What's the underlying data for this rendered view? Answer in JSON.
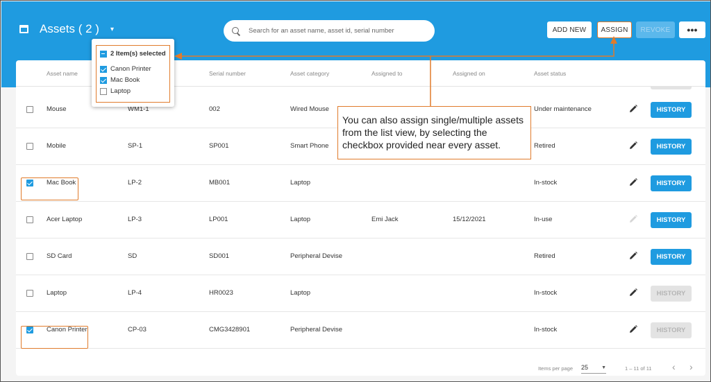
{
  "header": {
    "title": "Assets ( 2 )",
    "title_caret": "▾",
    "search_placeholder": "Search for an asset name, asset id, serial number",
    "add_new_label": "ADD NEW",
    "assign_label": "ASSIGN",
    "revoke_label": "REVOKE",
    "more_label": "•••"
  },
  "table": {
    "columns": [
      "Asset name",
      "",
      "Serial number",
      "Asset category",
      "Assigned to",
      "Assigned on",
      "Asset status"
    ],
    "rows": [
      {
        "checked": false,
        "name": "Mouse",
        "id": "WM1-1",
        "serial": "002",
        "category": "Wired Mouse",
        "assigned_to": "",
        "assigned_on": "",
        "status": "Under maintenance",
        "history": "HISTORY",
        "history_enabled": true
      },
      {
        "checked": false,
        "name": "Mobile",
        "id": "SP-1",
        "serial": "SP001",
        "category": "Smart Phone",
        "assigned_to": "",
        "assigned_on": "",
        "status": "Retired",
        "history": "HISTORY",
        "history_enabled": true
      },
      {
        "checked": true,
        "name": "Mac Book",
        "id": "LP-2",
        "serial": "MB001",
        "category": "Laptop",
        "assigned_to": "",
        "assigned_on": "",
        "status": "In-stock",
        "history": "HISTORY",
        "history_enabled": true
      },
      {
        "checked": false,
        "name": "Acer Laptop",
        "id": "LP-3",
        "serial": "LP001",
        "category": "Laptop",
        "assigned_to": "Emi Jack",
        "assigned_on": "15/12/2021",
        "status": "In-use",
        "history": "HISTORY",
        "history_enabled": true
      },
      {
        "checked": false,
        "name": "SD Card",
        "id": "SD",
        "serial": "SD001",
        "category": "Peripheral Devise",
        "assigned_to": "",
        "assigned_on": "",
        "status": "Retired",
        "history": "HISTORY",
        "history_enabled": true
      },
      {
        "checked": false,
        "name": "Laptop",
        "id": "LP-4",
        "serial": "HR0023",
        "category": "Laptop",
        "assigned_to": "",
        "assigned_on": "",
        "status": "In-stock",
        "history": "HISTORY",
        "history_enabled": false
      },
      {
        "checked": true,
        "name": "Canon Printer",
        "id": "CP-03",
        "serial": "CMG3428901",
        "category": "Peripheral Devise",
        "assigned_to": "",
        "assigned_on": "",
        "status": "In-stock",
        "history": "HISTORY",
        "history_enabled": false
      }
    ]
  },
  "selection_popup": {
    "header": "2 Item(s) selected",
    "items": [
      {
        "label": "Canon Printer",
        "checked": true
      },
      {
        "label": "Mac Book",
        "checked": true
      },
      {
        "label": "Laptop",
        "checked": false
      }
    ]
  },
  "callout": {
    "text": "You can also assign single/multiple assets from the list view, by selecting the checkbox provided near every asset."
  },
  "pagination": {
    "items_per_page_label": "Items per page",
    "page_size": "25",
    "range": "1 – 11 of 11",
    "prev": "‹",
    "next": "›"
  },
  "colors": {
    "header_bg": "#1f9be0",
    "accent": "#1f9be0",
    "highlight": "#e07b2b"
  }
}
